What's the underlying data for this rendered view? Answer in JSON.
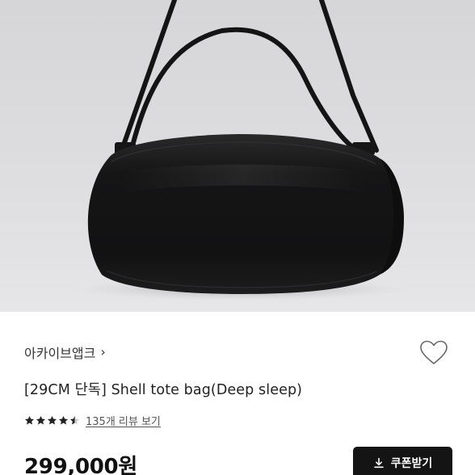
{
  "product": {
    "brand": "아카이브앱크",
    "brand_chevron": "›",
    "title": "[29CM 단독] Shell tote bag(Deep sleep)",
    "rating": 4.5,
    "review_link": "135개 리뷰 보기",
    "price": "299,000원"
  },
  "actions": {
    "coupon_label": "쿠폰받기",
    "coupon_icon": "download-icon",
    "like_icon": "heart-outline-icon"
  },
  "colors": {
    "button_bg": "#141414",
    "bag": "#151515",
    "photo_bg": "#dcdcde"
  }
}
